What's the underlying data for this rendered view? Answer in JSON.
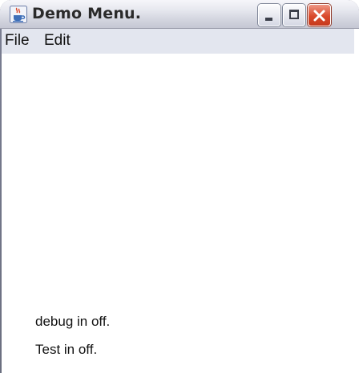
{
  "window": {
    "title": "Demo Menu.",
    "app_icon": "java-cup-icon",
    "controls": {
      "minimize": "minimize-icon",
      "maximize": "maximize-icon",
      "close": "close-icon"
    }
  },
  "menubar": {
    "items": [
      {
        "label": "File"
      },
      {
        "label": "Edit"
      }
    ]
  },
  "content": {
    "status_lines": [
      "debug in off.",
      "Test in off."
    ]
  },
  "colors": {
    "menubar_bg": "#e3e6ef",
    "close_button": "#d9492b",
    "content_bg": "#ffffff"
  }
}
